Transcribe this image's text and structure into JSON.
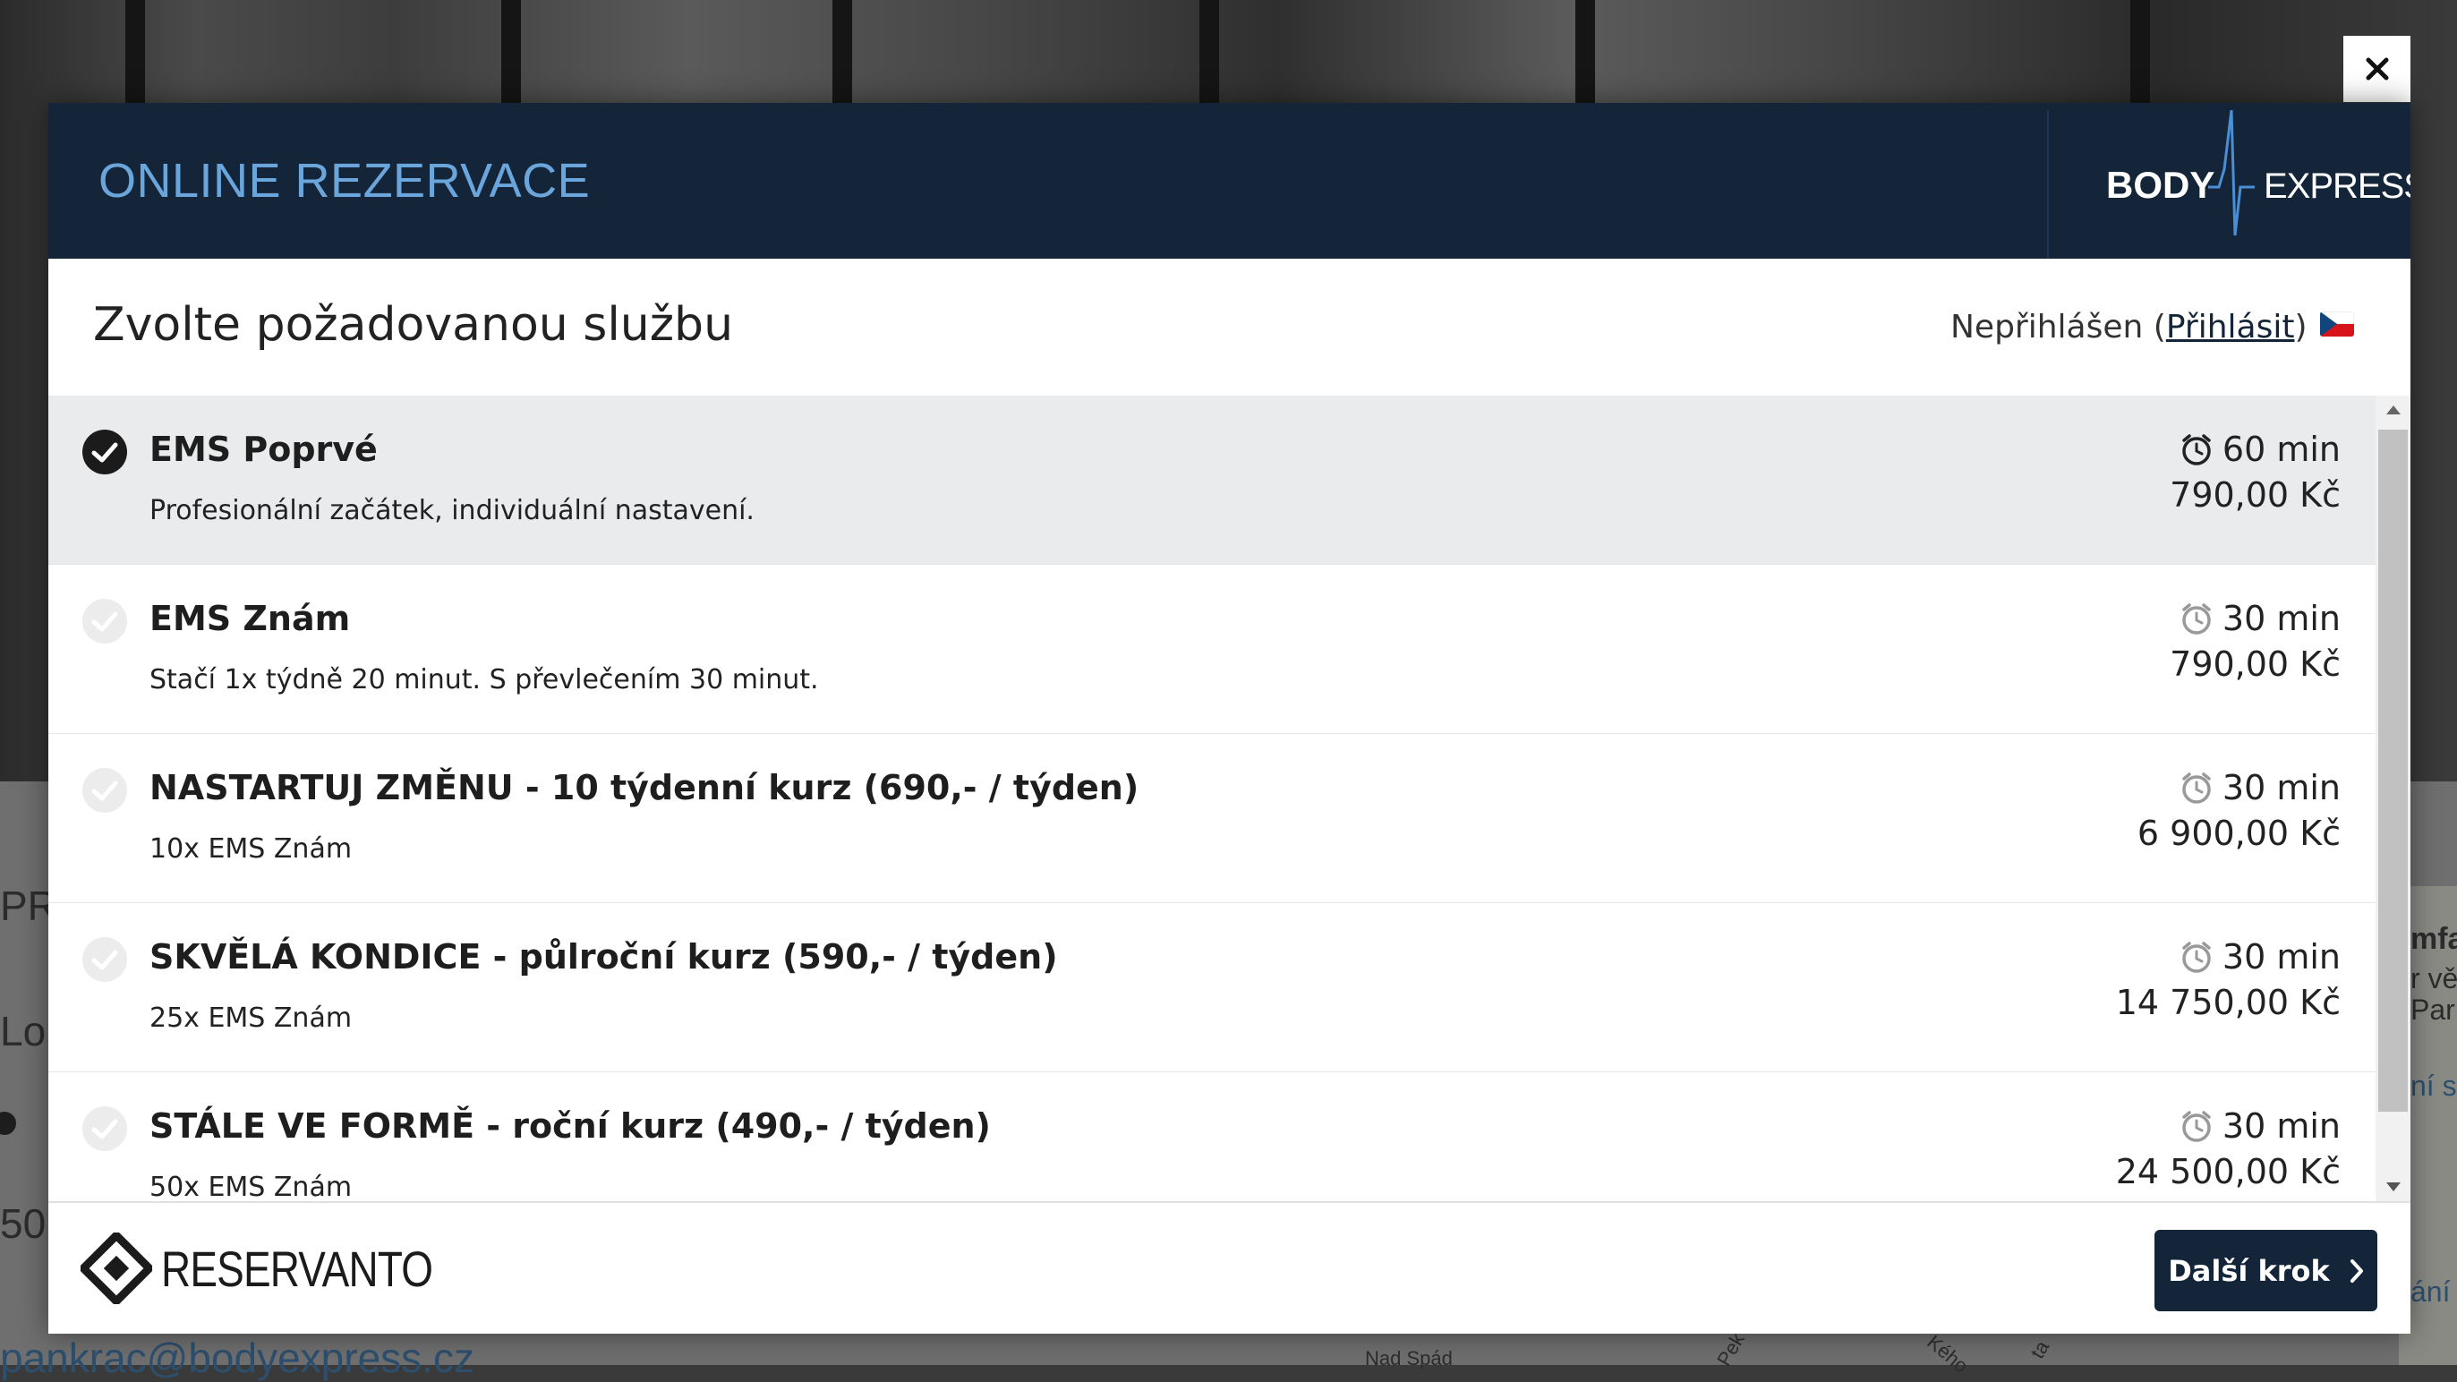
{
  "background": {
    "left_texts": [
      "PR",
      "Lon",
      "50"
    ],
    "right_texts": [
      "mfa",
      "r vě",
      "Par",
      "ní s",
      "ání"
    ],
    "email": "pankrac@bodyexpress.cz",
    "map_labels": [
      "Nad Spád",
      "Pek",
      "Kého",
      "ta"
    ]
  },
  "modal": {
    "title": "ONLINE REZERVACE",
    "logo": {
      "left": "BODY",
      "right": "EXPRESS"
    },
    "step_title": "Zvolte požadovanou službu",
    "login": {
      "status": "Nepřihlášen (",
      "link": "Přihlásit",
      "close_paren": ")"
    },
    "language_flag": "cz-flag-icon"
  },
  "services": [
    {
      "name": "EMS Poprvé",
      "description": "Profesionální začátek, individuální nastavení.",
      "duration": "60 min",
      "price": "790,00 Kč",
      "selected": true
    },
    {
      "name": "EMS Znám",
      "description": "Stačí 1x týdně 20 minut. S převlečením 30 minut.",
      "duration": "30 min",
      "price": "790,00 Kč",
      "selected": false
    },
    {
      "name": "NASTARTUJ ZMĚNU - 10 týdenní kurz (690,- / týden)",
      "description": "10x EMS Znám",
      "duration": "30 min",
      "price": "6 900,00 Kč",
      "selected": false
    },
    {
      "name": "SKVĚLÁ KONDICE - půlroční kurz (590,- / týden)",
      "description": "25x EMS Znám",
      "duration": "30 min",
      "price": "14 750,00 Kč",
      "selected": false
    },
    {
      "name": "STÁLE VE FORMĚ - roční kurz (490,- / týden)",
      "description": "50x EMS Znám",
      "duration": "30 min",
      "price": "24 500,00 Kč",
      "selected": false
    }
  ],
  "footer": {
    "brand": "RESERVANTO",
    "next_button": "Další krok"
  },
  "colors": {
    "header_bg": "#14253a",
    "title_color": "#6aa6dc",
    "selected_row": "#e9ebec",
    "button_bg": "#14253a"
  }
}
